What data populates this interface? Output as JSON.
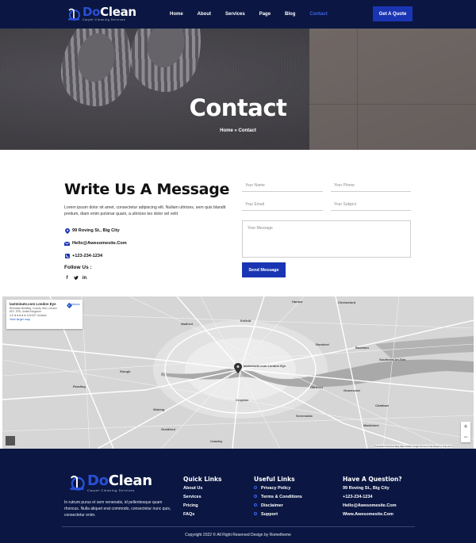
{
  "brand": {
    "name_part1": "Do",
    "name_part2": "Clean",
    "tagline": "Carpet Cleaning Services",
    "accent_color": "#1a35b3",
    "navy_color": "#0b1742"
  },
  "nav": {
    "items": [
      "Home",
      "About",
      "Services",
      "Page",
      "Blog",
      "Contact"
    ],
    "active_index": 5,
    "quote_button": "Get A Quote"
  },
  "hero": {
    "title": "Contact",
    "breadcrumb": "Home » Contact"
  },
  "contact": {
    "title": "Write Us A Message",
    "intro": "Lorem ipsum dolor sit amet, consectetur adipiscing elit. Nullam ultricies, sem quis blandit pretium, diam enim pulvinar quam, a ultricies leo dolor vel velit",
    "address": "99 Roving St., Big City",
    "email": "Hello@Awesomesite.Com",
    "phone": "+123-234-1234",
    "address_icon": "map-pin-icon",
    "email_icon": "mail-icon",
    "phone_icon": "phone-icon",
    "follow_label": "Follow Us :",
    "socials": [
      "f",
      "t",
      "in"
    ]
  },
  "form": {
    "name_placeholder": "Your Name",
    "phone_placeholder": "Your Phone",
    "email_placeholder": "Your Email",
    "subject_placeholder": "Your Subject",
    "message_placeholder": "Your Message",
    "submit_label": "Send Message"
  },
  "map": {
    "place_title": "lastminute.com London Eye",
    "place_address": "Riverside Building, County Hall, London SE1 7PB, United Kingdom",
    "rating": "4.5 ★★★★★ 145,927 reviews",
    "view_larger": "View larger map",
    "directions": "Directions",
    "pin_label": "lastminute.com London Eye",
    "labels": [
      "Harlow",
      "Watford",
      "Chelmsford",
      "Enfield",
      "Romford",
      "Basildon",
      "Southend-on-Sea",
      "Slough",
      "Reading",
      "Croydon",
      "Woking",
      "Guildford",
      "Dartford",
      "Gravesend",
      "Chatham",
      "Crawley",
      "Maidstone",
      "Sevenoaks"
    ],
    "zoom_in": "+",
    "zoom_out": "−",
    "footer_text": "Keyboard shortcuts   Map data ©2022 Google   Terms of Use   Report a map error"
  },
  "footer": {
    "about": "In rutrum purus et sem venenatis, id pellentesque quam rhoncus. Nulla aliquet erat commodo, consectetur nunc quis, consectetur enim.",
    "quick_links_title": "Quick Links",
    "quick_links": [
      "About Us",
      "Services",
      "Pricing",
      "FAQs"
    ],
    "useful_links_title": "Useful Links",
    "useful_links": [
      "Privacy Policy",
      "Terms & Conditions",
      "Disclaimer",
      "Support"
    ],
    "question_title": "Have A Question?",
    "question_lines": [
      "99 Roving St., Big City",
      "+123-234-1234",
      "Hello@Awesomesite.Com",
      "Www.Awesomesite.Com"
    ],
    "copyright": "Copyright 2022 © All Right Reserved Design by Rometheme"
  }
}
